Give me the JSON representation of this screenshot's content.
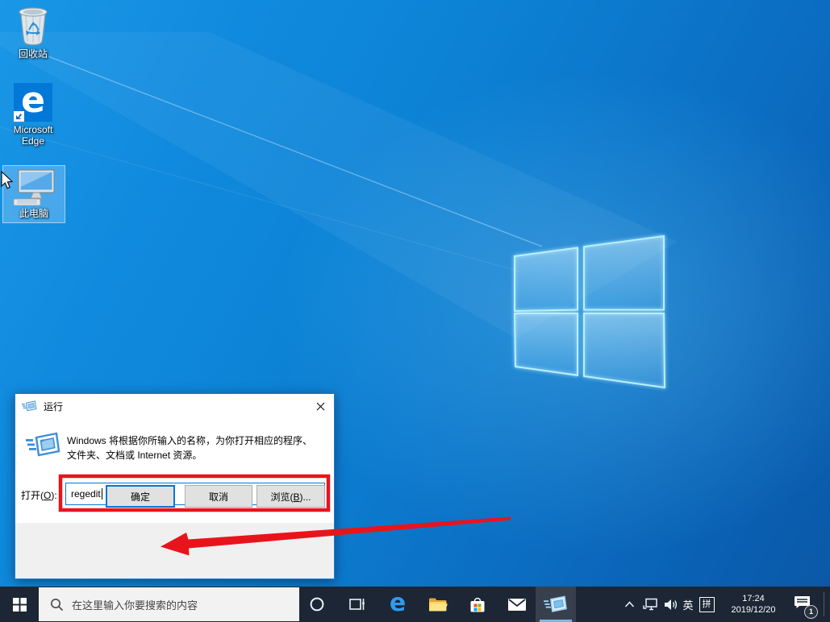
{
  "colors": {
    "accent_blue": "#0078d7",
    "annotation_red": "#e8141c",
    "taskbar_bg": "#1c2634",
    "wallpaper_blue": "#0d83d6",
    "selection_highlight": "#96cdfa"
  },
  "desktop": {
    "icons": [
      {
        "label": "回收站"
      },
      {
        "label": "Microsoft Edge"
      },
      {
        "label": "此电脑",
        "selected": true
      }
    ]
  },
  "run_dialog": {
    "title": "运行",
    "description_line1": "Windows 将根据你所输入的名称，为你打开相应的程序、",
    "description_line2": "文件夹、文档或 Internet 资源。",
    "open_label_pre": "打开(",
    "open_label_key": "O",
    "open_label_post": "):",
    "input_value": "regedit",
    "ok_label": "确定",
    "cancel_label": "取消",
    "browse_pre": "浏览(",
    "browse_key": "B",
    "browse_post": ")..."
  },
  "taskbar": {
    "search_placeholder": "在这里输入你要搜索的内容",
    "tray": {
      "ime_language": "英",
      "ime_mode": "拼",
      "time": "17:24",
      "date": "2019/12/20",
      "notification_badge": "1"
    }
  },
  "icons": {
    "wallpaper": "windows-logo-icon",
    "dialog_app": "run-icon",
    "search": "magnifier-icon",
    "cortana": "cortana-ring-icon",
    "task_view": "task-view-icon",
    "browser": "edge-icon",
    "files": "folder-icon",
    "store": "store-bag-icon",
    "mail": "envelope-icon",
    "tray_expand": "chevron-up-icon",
    "network": "ethernet-icon",
    "volume": "speaker-icon",
    "notifications": "comment-icon",
    "close": "close-x-icon"
  }
}
